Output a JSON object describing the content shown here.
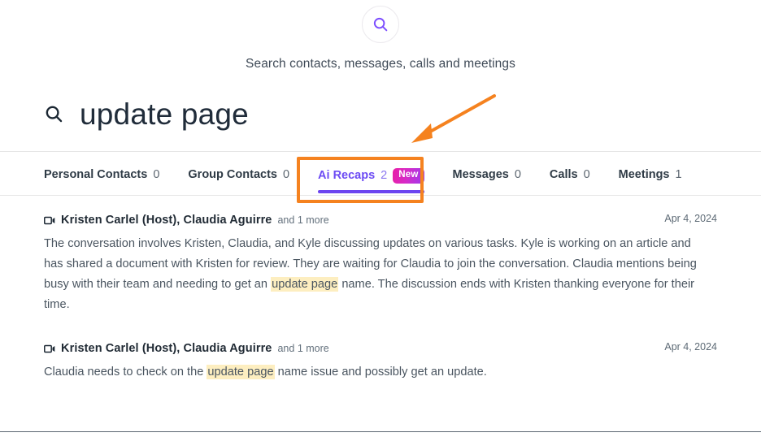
{
  "header": {
    "search_icon": "search-icon",
    "subtitle": "Search contacts, messages, calls and meetings"
  },
  "query": {
    "icon": "search-icon",
    "text": "update page"
  },
  "tabs": [
    {
      "label": "Personal Contacts",
      "count": "0",
      "active": false,
      "badge": null
    },
    {
      "label": "Group Contacts",
      "count": "0",
      "active": false,
      "badge": null
    },
    {
      "label": "Ai Recaps",
      "count": "2",
      "active": true,
      "badge": "New"
    },
    {
      "label": "Messages",
      "count": "0",
      "active": false,
      "badge": null
    },
    {
      "label": "Calls",
      "count": "0",
      "active": false,
      "badge": null
    },
    {
      "label": "Meetings",
      "count": "1",
      "active": false,
      "badge": null
    }
  ],
  "annotation": {
    "box_target": "Ai Recaps",
    "color": "#f5821f",
    "arrow": "arrow-pointing-down-left"
  },
  "results": [
    {
      "icon": "video-camera-icon",
      "names": "Kristen Carlel (Host), Claudia Aguirre",
      "more": "and 1 more",
      "date": "Apr 4, 2024",
      "body_before": "The conversation involves Kristen, Claudia, and Kyle discussing updates on various tasks. Kyle is working on an article and has shared a document with Kristen for review. They are waiting for Claudia to join the conversation. Claudia mentions being busy with their team and needing to get an ",
      "body_highlight": "update page",
      "body_after": " name. The discussion ends with Kristen thanking everyone for their time."
    },
    {
      "icon": "video-camera-icon",
      "names": "Kristen Carlel (Host), Claudia Aguirre",
      "more": "and 1 more",
      "date": "Apr 4, 2024",
      "body_before": "Claudia needs to check on the ",
      "body_highlight": "update page",
      "body_after": " name issue and possibly get an update."
    }
  ],
  "colors": {
    "accent_purple": "#6c4bf4",
    "annotation_orange": "#f5821f",
    "highlight_yellow": "#fdeec0",
    "badge_gradient_start": "#e81fa6",
    "badge_gradient_end": "#9b3bef"
  }
}
